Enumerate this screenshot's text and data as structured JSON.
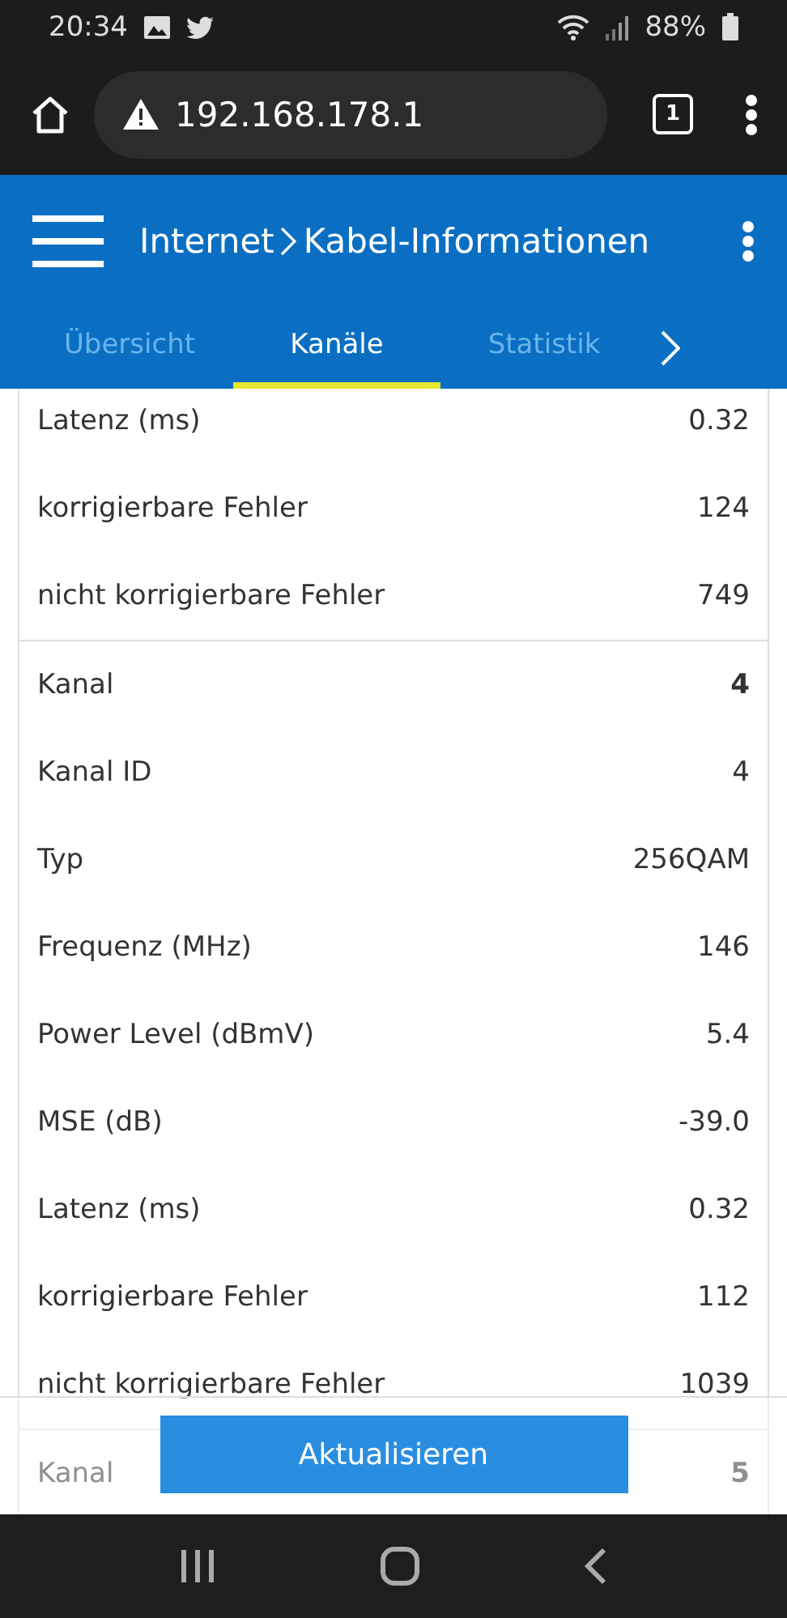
{
  "status_bar": {
    "time": "20:34",
    "battery": "88%"
  },
  "browser": {
    "url": "192.168.178.1",
    "tab_count": "1"
  },
  "header": {
    "section": "Internet",
    "page": "Kabel-Informationen"
  },
  "tabs": [
    {
      "label": "Übersicht",
      "selected": false
    },
    {
      "label": "Kanäle",
      "selected": true
    },
    {
      "label": "Statistik",
      "selected": false
    }
  ],
  "groups": [
    {
      "rows": [
        {
          "kind": "field",
          "label": "Latenz (ms)",
          "value": "0.32"
        },
        {
          "kind": "field",
          "label": "korrigierbare Fehler",
          "value": "124"
        },
        {
          "kind": "field",
          "label": "nicht korrigierbare Fehler",
          "value": "749"
        }
      ]
    },
    {
      "rows": [
        {
          "kind": "channel",
          "label": "Kanal",
          "value": "4"
        },
        {
          "kind": "field",
          "label": "Kanal ID",
          "value": "4"
        },
        {
          "kind": "field",
          "label": "Typ",
          "value": "256QAM"
        },
        {
          "kind": "field",
          "label": "Frequenz (MHz)",
          "value": "146"
        },
        {
          "kind": "field",
          "label": "Power Level (dBmV)",
          "value": "5.4"
        },
        {
          "kind": "field",
          "label": "MSE (dB)",
          "value": "-39.0"
        },
        {
          "kind": "field",
          "label": "Latenz (ms)",
          "value": "0.32"
        },
        {
          "kind": "field",
          "label": "korrigierbare Fehler",
          "value": "112"
        },
        {
          "kind": "field",
          "label": "nicht korrigierbare Fehler",
          "value": "1039"
        }
      ]
    },
    {
      "rows": [
        {
          "kind": "channel",
          "label": "Kanal",
          "value": "5"
        }
      ]
    }
  ],
  "refresh_button": "Aktualisieren"
}
